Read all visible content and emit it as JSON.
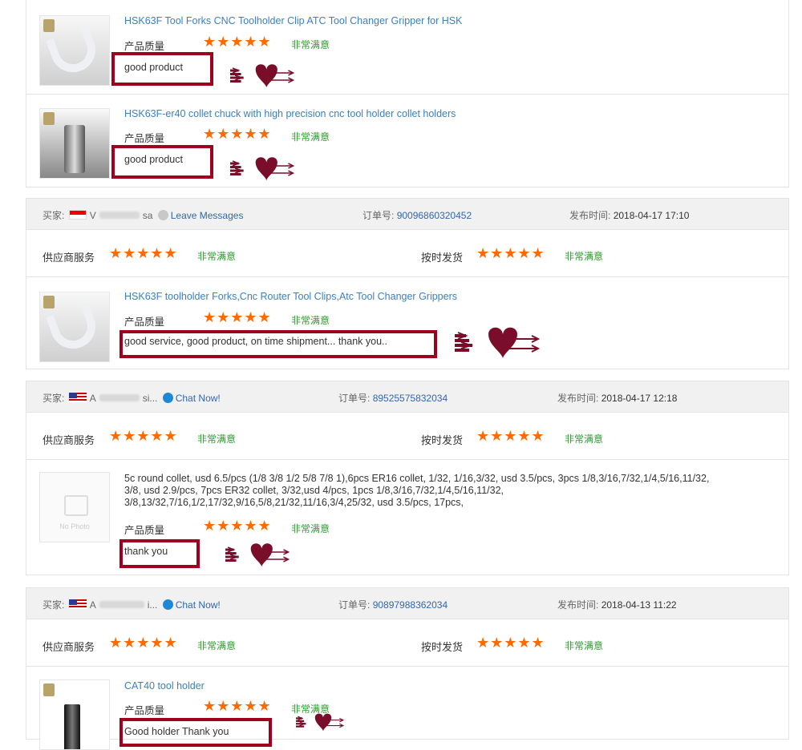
{
  "common": {
    "quality_label": "产品质量",
    "supplier_service_label": "供应商服务",
    "on_time_label": "按时发货",
    "satisfied": "非常满意",
    "stars": "★★★★★",
    "buyer_label": "买家:",
    "order_label": "订单号:",
    "time_label": "发布时间:",
    "no_photo": "No Photo"
  },
  "colors": {
    "accent_link": "#3a7fc6",
    "star": "#ff6a00",
    "satisfied": "#2a9d2a",
    "highlight": "#a0001e"
  },
  "block1": {
    "products": [
      {
        "title": "HSK63F Tool Forks CNC Toolholder Clip ATC Tool Changer Gripper for HSK",
        "review": "good product"
      },
      {
        "title": "HSK63F-er40 collet chuck with high precision cnc tool holder collet holders",
        "review": "good product"
      }
    ]
  },
  "block2": {
    "buyer_name_start": "V",
    "buyer_name_end": "sa",
    "action": "Leave Messages",
    "order_no": "90096860320452",
    "time": "2018-04-17 17:10",
    "product": {
      "title": "HSK63F toolholder Forks,Cnc Router Tool Clips,Atc Tool Changer Grippers",
      "review": "good service, good product, on time shipment... thank you.."
    }
  },
  "block3": {
    "buyer_name_start": "A",
    "buyer_name_end": "si...",
    "action": "Chat Now!",
    "order_no": "89525575832034",
    "time": "2018-04-17 12:18",
    "product": {
      "desc": "5c round collet, usd 6.5/pcs (1/8 3/8 1/2 5/8 7/8 1),6pcs ER16 collet, 1/32, 1/16,3/32, usd 3.5/pcs, 3pcs 1/8,3/16,7/32,1/4,5/16,11/32, 3/8, usd 2.9/pcs, 7pcs ER32 collet, 3/32,usd 4/pcs, 1pcs 1/8,3/16,7/32,1/4,5/16,11/32, 3/8,13/32,7/16,1/2,17/32,9/16,5/8,21/32,11/16,3/4,25/32, usd 3.5/pcs, 17pcs,",
      "review": "thank you"
    }
  },
  "block4": {
    "buyer_name_start": "A",
    "buyer_name_end": "i...",
    "action": "Chat Now!",
    "order_no": "90897988362034",
    "time": "2018-04-13 11:22",
    "product": {
      "title": "CAT40 tool holder",
      "review": "Good holder Thank you"
    }
  }
}
